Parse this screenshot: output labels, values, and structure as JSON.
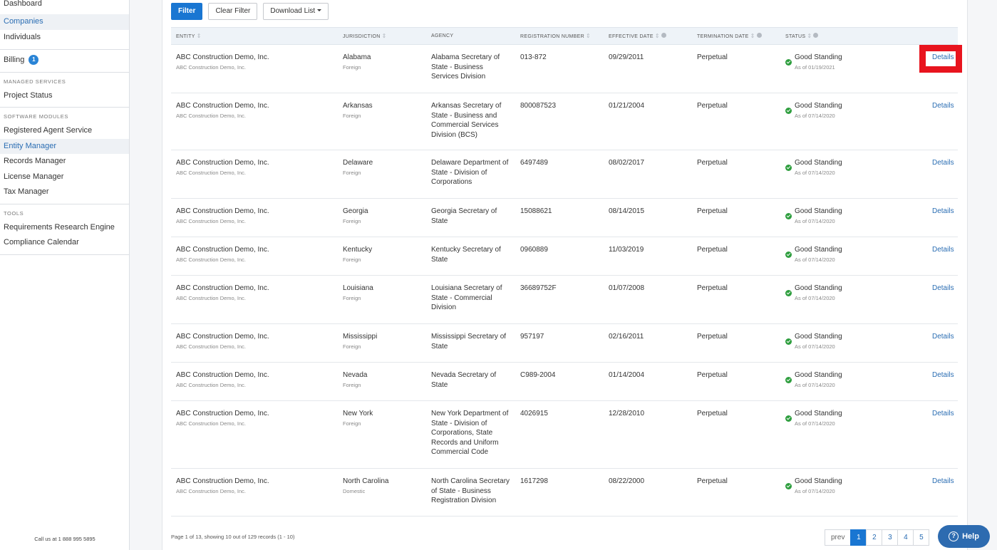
{
  "sidebar": {
    "top_items": [
      "Dashboard",
      "Companies",
      "Individuals"
    ],
    "billing_label": "Billing",
    "billing_badge": "1",
    "managed_heading": "MANAGED SERVICES",
    "managed_items": [
      "Project Status"
    ],
    "software_heading": "SOFTWARE MODULES",
    "software_items": [
      "Registered Agent Service",
      "Entity Manager",
      "Records Manager",
      "License Manager",
      "Tax Manager"
    ],
    "tools_heading": "TOOLS",
    "tools_items": [
      "Requirements Research Engine",
      "Compliance Calendar"
    ],
    "call_us": "Call us at 1  888  995  5895"
  },
  "toolbar": {
    "filter_label": "Filter",
    "clear_label": "Clear Filter",
    "download_label": "Download List"
  },
  "table": {
    "headers": {
      "entity": "ENTITY",
      "jurisdiction": "JURISDICTION",
      "agency": "AGENCY",
      "registration": "REGISTRATION NUMBER",
      "effective": "EFFECTIVE DATE",
      "termination": "TERMINATION DATE",
      "status": "STATUS"
    },
    "details_label": "Details",
    "rows": [
      {
        "entity": "ABC Construction Demo, Inc.",
        "entity_sub": "ABC Construction Demo, Inc.",
        "jurisdiction": "Alabama",
        "jur_type": "Foreign",
        "agency": "Alabama Secretary of State - Business Services Division",
        "reg": "013-872",
        "effective": "09/29/2011",
        "termination": "Perpetual",
        "status": "Good Standing",
        "status_date": "As of 01/19/2021"
      },
      {
        "entity": "ABC Construction Demo, Inc.",
        "entity_sub": "ABC Construction Demo, Inc.",
        "jurisdiction": "Arkansas",
        "jur_type": "Foreign",
        "agency": "Arkansas Secretary of State - Business and Commercial Services Division (BCS)",
        "reg": "800087523",
        "effective": "01/21/2004",
        "termination": "Perpetual",
        "status": "Good Standing",
        "status_date": "As of 07/14/2020"
      },
      {
        "entity": "ABC Construction Demo, Inc.",
        "entity_sub": "ABC Construction Demo, Inc.",
        "jurisdiction": "Delaware",
        "jur_type": "Foreign",
        "agency": "Delaware Department of State - Division of Corporations",
        "reg": "6497489",
        "effective": "08/02/2017",
        "termination": "Perpetual",
        "status": "Good Standing",
        "status_date": "As of 07/14/2020"
      },
      {
        "entity": "ABC Construction Demo, Inc.",
        "entity_sub": "ABC Construction Demo, Inc.",
        "jurisdiction": "Georgia",
        "jur_type": "Foreign",
        "agency": "Georgia Secretary of State",
        "reg": "15088621",
        "effective": "08/14/2015",
        "termination": "Perpetual",
        "status": "Good Standing",
        "status_date": "As of 07/14/2020"
      },
      {
        "entity": "ABC Construction Demo, Inc.",
        "entity_sub": "ABC Construction Demo, Inc.",
        "jurisdiction": "Kentucky",
        "jur_type": "Foreign",
        "agency": "Kentucky Secretary of State",
        "reg": "0960889",
        "effective": "11/03/2019",
        "termination": "Perpetual",
        "status": "Good Standing",
        "status_date": "As of 07/14/2020"
      },
      {
        "entity": "ABC Construction Demo, Inc.",
        "entity_sub": "ABC Construction Demo, Inc.",
        "jurisdiction": "Louisiana",
        "jur_type": "Foreign",
        "agency": "Louisiana Secretary of State - Commercial Division",
        "reg": "36689752F",
        "effective": "01/07/2008",
        "termination": "Perpetual",
        "status": "Good Standing",
        "status_date": "As of 07/14/2020"
      },
      {
        "entity": "ABC Construction Demo, Inc.",
        "entity_sub": "ABC Construction Demo, Inc.",
        "jurisdiction": "Mississippi",
        "jur_type": "Foreign",
        "agency": "Mississippi Secretary of State",
        "reg": "957197",
        "effective": "02/16/2011",
        "termination": "Perpetual",
        "status": "Good Standing",
        "status_date": "As of 07/14/2020"
      },
      {
        "entity": "ABC Construction Demo, Inc.",
        "entity_sub": "ABC Construction Demo, Inc.",
        "jurisdiction": "Nevada",
        "jur_type": "Foreign",
        "agency": "Nevada Secretary of State",
        "reg": "C989-2004",
        "effective": "01/14/2004",
        "termination": "Perpetual",
        "status": "Good Standing",
        "status_date": "As of 07/14/2020"
      },
      {
        "entity": "ABC Construction Demo, Inc.",
        "entity_sub": "ABC Construction Demo, Inc.",
        "jurisdiction": "New York",
        "jur_type": "Foreign",
        "agency": "New York Department of State - Division of Corporations, State Records and Uniform Commercial Code",
        "reg": "4026915",
        "effective": "12/28/2010",
        "termination": "Perpetual",
        "status": "Good Standing",
        "status_date": "As of 07/14/2020"
      },
      {
        "entity": "ABC Construction Demo, Inc.",
        "entity_sub": "ABC Construction Demo, Inc.",
        "jurisdiction": "North Carolina",
        "jur_type": "Domestic",
        "agency": "North Carolina Secretary of State - Business Registration Division",
        "reg": "1617298",
        "effective": "08/22/2000",
        "termination": "Perpetual",
        "status": "Good Standing",
        "status_date": "As of 07/14/2020"
      }
    ]
  },
  "footer": {
    "summary": "Page 1 of 13, showing 10 out of 129 records (1 - 10)",
    "prev_label": "prev",
    "pages": [
      "1",
      "2",
      "3",
      "4",
      "5"
    ],
    "current_page": "1"
  },
  "help": {
    "label": "Help",
    "icon": "question-circle-icon"
  },
  "colors": {
    "accent": "#1976d2",
    "link": "#2a6db3",
    "status_ok": "#2e9e3e",
    "highlight": "#e8141e",
    "help_bg": "#2d6bb0"
  }
}
